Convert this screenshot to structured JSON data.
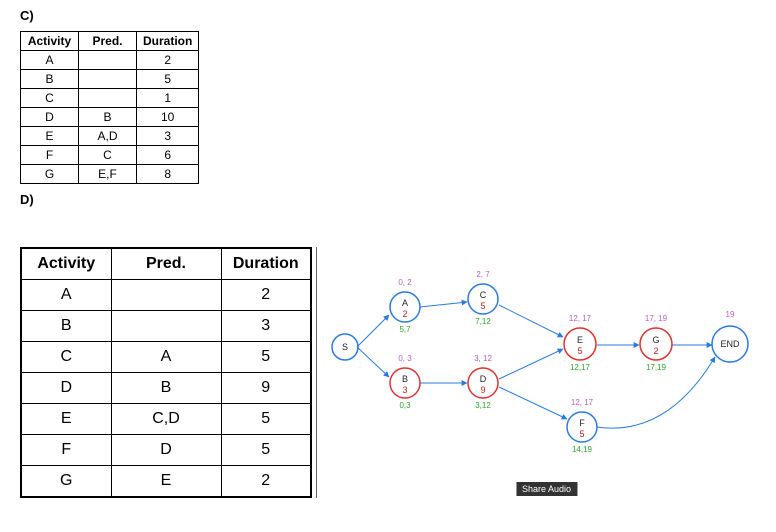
{
  "c": {
    "label": "C)",
    "headers": [
      "Activity",
      "Pred.",
      "Duration"
    ],
    "rows": [
      {
        "a": "A",
        "p": "",
        "d": "2"
      },
      {
        "a": "B",
        "p": "",
        "d": "5"
      },
      {
        "a": "C",
        "p": "",
        "d": "1"
      },
      {
        "a": "D",
        "p": "B",
        "d": "10"
      },
      {
        "a": "E",
        "p": "A,D",
        "d": "3"
      },
      {
        "a": "F",
        "p": "C",
        "d": "6"
      },
      {
        "a": "G",
        "p": "E,F",
        "d": "8"
      }
    ]
  },
  "d": {
    "label": "D)",
    "headers": [
      "Activity",
      "Pred.",
      "Duration"
    ],
    "rows": [
      {
        "a": "A",
        "p": "",
        "d": "2"
      },
      {
        "a": "B",
        "p": "",
        "d": "3"
      },
      {
        "a": "C",
        "p": "A",
        "d": "5"
      },
      {
        "a": "D",
        "p": "B",
        "d": "9"
      },
      {
        "a": "E",
        "p": "C,D",
        "d": "5"
      },
      {
        "a": "F",
        "p": "D",
        "d": "5"
      },
      {
        "a": "G",
        "p": "E",
        "d": "2"
      }
    ]
  },
  "chart_data": {
    "type": "network",
    "nodes": [
      {
        "id": "S",
        "dur": "",
        "es_ef": "",
        "ls_lf": "",
        "color": "#2a7ae2"
      },
      {
        "id": "A",
        "dur": "2",
        "es_ef": "0, 2",
        "ls_lf": "5,7",
        "color": "#2a7ae2"
      },
      {
        "id": "B",
        "dur": "3",
        "es_ef": "0, 3",
        "ls_lf": "0,3",
        "color": "#e03030"
      },
      {
        "id": "C",
        "dur": "5",
        "es_ef": "2, 7",
        "ls_lf": "7,12",
        "color": "#2a7ae2"
      },
      {
        "id": "D",
        "dur": "9",
        "es_ef": "3, 12",
        "ls_lf": "3,12",
        "color": "#e03030"
      },
      {
        "id": "E",
        "dur": "5",
        "es_ef": "12, 17",
        "ls_lf": "12,17",
        "color": "#e03030"
      },
      {
        "id": "F",
        "dur": "5",
        "es_ef": "12, 17",
        "ls_lf": "14,19",
        "color": "#2a7ae2"
      },
      {
        "id": "G",
        "dur": "2",
        "es_ef": "17, 19",
        "ls_lf": "17,19",
        "color": "#e03030"
      },
      {
        "id": "END",
        "dur": "",
        "es_ef": "19",
        "ls_lf": "",
        "color": "#2a7ae2"
      }
    ],
    "edges": [
      [
        "S",
        "A"
      ],
      [
        "S",
        "B"
      ],
      [
        "A",
        "C"
      ],
      [
        "B",
        "D"
      ],
      [
        "C",
        "E"
      ],
      [
        "D",
        "E"
      ],
      [
        "D",
        "F"
      ],
      [
        "E",
        "G"
      ],
      [
        "G",
        "END"
      ],
      [
        "F",
        "END"
      ]
    ]
  },
  "share_audio": "Share Audio"
}
